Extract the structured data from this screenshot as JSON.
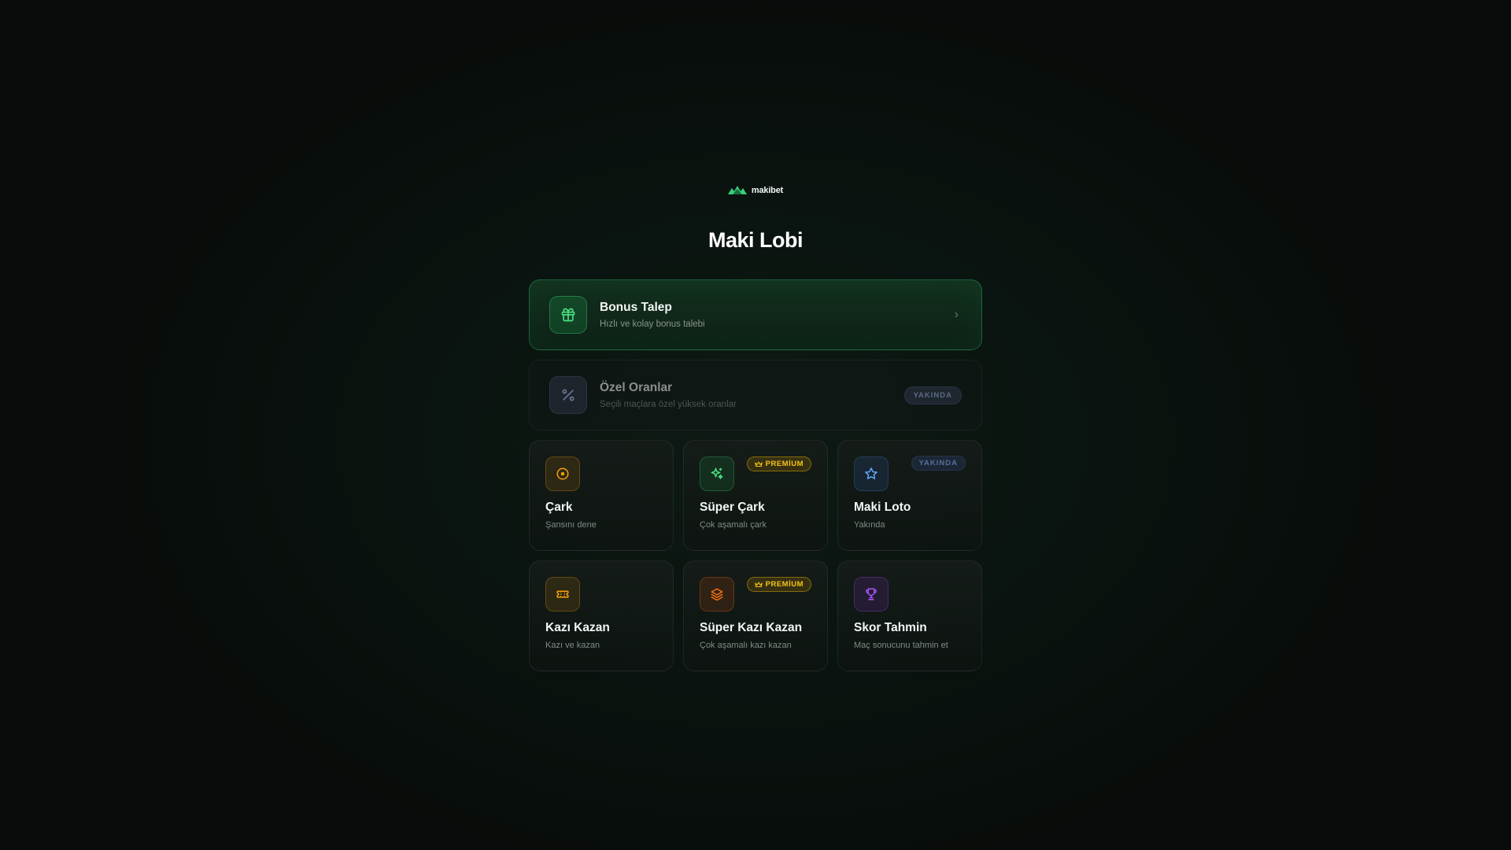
{
  "brand": {
    "name": "makibet",
    "logo_icon": "crown-mountain-logo",
    "accent": "#22c55e"
  },
  "page": {
    "title": "Maki Lobi"
  },
  "rows": [
    {
      "title": "Bonus Talep",
      "subtitle": "Hızlı ve kolay bonus talebi",
      "icon": "gift-icon",
      "state": "active"
    },
    {
      "title": "Özel Oranlar",
      "subtitle": "Seçili maçlara özel yüksek oranlar",
      "icon": "percent-icon",
      "badge": "YAKINDA",
      "state": "disabled"
    }
  ],
  "tiles": [
    {
      "title": "Çark",
      "subtitle": "Şansını dene",
      "icon": "wheel-icon"
    },
    {
      "title": "Süper Çark",
      "subtitle": "Çok aşamalı çark",
      "icon": "sparkles-icon",
      "badge": "PREMİUM"
    },
    {
      "title": "Maki Loto",
      "subtitle": "Yakında",
      "icon": "star-icon",
      "badge": "YAKINDA"
    },
    {
      "title": "Kazı Kazan",
      "subtitle": "Kazı ve kazan",
      "icon": "ticket-icon"
    },
    {
      "title": "Süper Kazı Kazan",
      "subtitle": "Çok aşamalı kazı kazan",
      "icon": "layers-icon",
      "badge": "PREMİUM"
    },
    {
      "title": "Skor Tahmin",
      "subtitle": "Maç sonucunu tahmin et",
      "icon": "trophy-icon"
    }
  ]
}
